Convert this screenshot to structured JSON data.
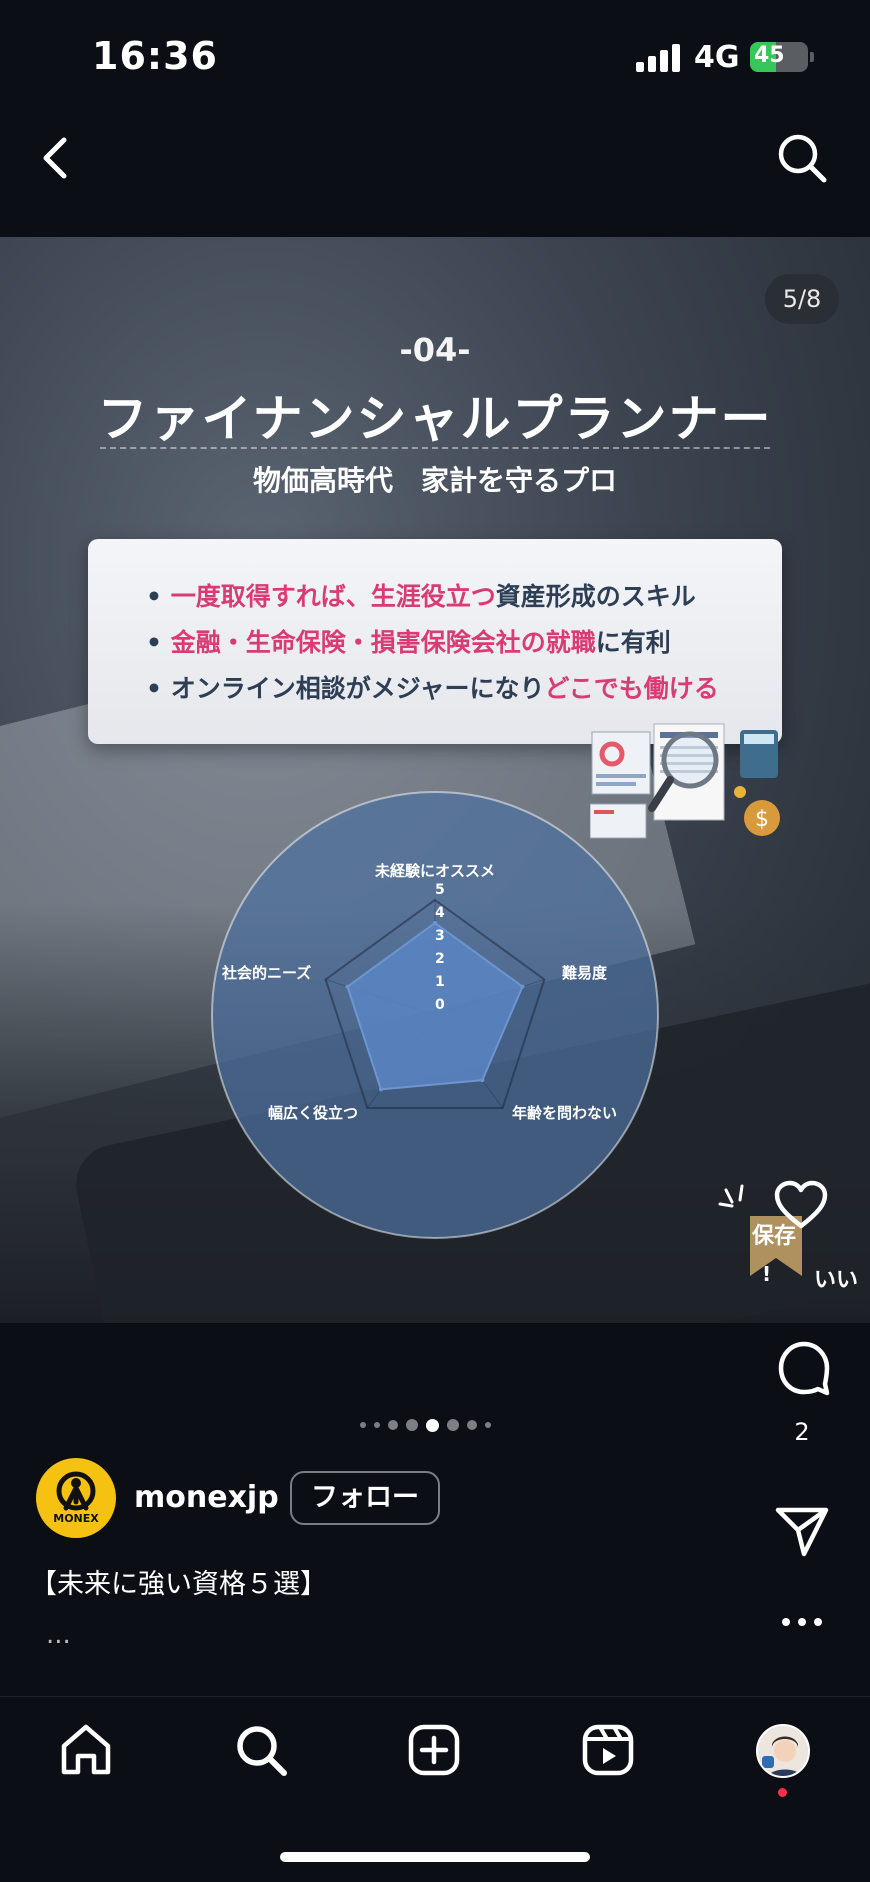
{
  "status_bar": {
    "time": "16:36",
    "network": "4G",
    "battery": "45",
    "battery_level": 0.45
  },
  "slide": {
    "counter": "5/8",
    "number_label": "-04-",
    "title": "ファイナンシャルプランナー",
    "subtitle": "物価高時代　家計を守るプロ",
    "bullets": [
      {
        "pink": "一度取得すれば、生涯役立つ",
        "dark": "資産形成のスキル",
        "order": "pink-first"
      },
      {
        "pink": "金融・生命保険・損害保険会社の就職",
        "dark": "に有利",
        "order": "pink-first"
      },
      {
        "dark": "オンライン相談がメジャーになり",
        "pink": "どこでも働ける",
        "order": "dark-first"
      }
    ],
    "bullet_mark": "•",
    "radar": {
      "axes": [
        "未経験にオススメ",
        "難易度",
        "年齢を問わない",
        "幅広く役立つ",
        "社会的ニーズ"
      ],
      "ticks": [
        "5",
        "4",
        "3",
        "2",
        "1",
        "0"
      ],
      "max": 5,
      "values": [
        4,
        4,
        3.5,
        4,
        4
      ]
    },
    "save_label": "保存",
    "good_label": "いい",
    "excl": "!"
  },
  "pagination": {
    "count": 8,
    "active": 4
  },
  "actions": {
    "comment_count": "2"
  },
  "author": {
    "username": "monexjp",
    "follow_label": "フォロー",
    "avatar_text": "MONEX"
  },
  "caption": {
    "text": "【未来に強い資格５選】",
    "more": "..."
  },
  "colors": {
    "accent_pink": "#d83c73",
    "card_text": "#2d3e55",
    "radar_fill": "#5b86c4",
    "brand_yellow": "#f6c211"
  }
}
